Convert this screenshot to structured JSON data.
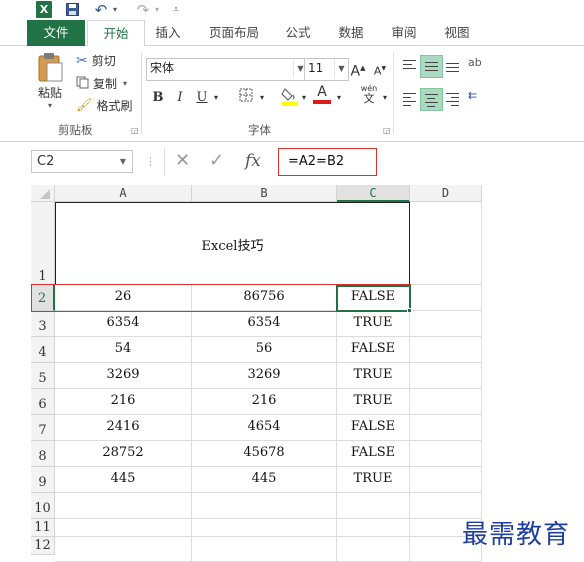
{
  "qat": {
    "excel_icon_letter": "X",
    "undo_glyph": "↶",
    "redo_glyph": "↷"
  },
  "tabs": {
    "file": "文件",
    "home": "开始",
    "insert": "插入",
    "page_layout": "页面布局",
    "formulas": "公式",
    "data": "数据",
    "review": "审阅",
    "view": "视图"
  },
  "clipboard": {
    "paste": "粘贴",
    "cut": "剪切",
    "copy": "复制",
    "format_painter": "格式刷",
    "group_label": "剪贴板"
  },
  "font": {
    "family": "宋体",
    "size": "11",
    "bold": "B",
    "italic": "I",
    "underline": "U",
    "phonetic_top": "wén",
    "phonetic_bottom": "文",
    "group_label": "字体",
    "grow": "A",
    "shrink": "A",
    "font_color_letter": "A"
  },
  "formula_bar": {
    "name_box": "C2",
    "cancel": "✕",
    "enter": "✓",
    "fx": "fx",
    "formula": "=A2=B2"
  },
  "columns": [
    "A",
    "B",
    "C",
    "D"
  ],
  "rows": [
    "1",
    "2",
    "3",
    "4",
    "5",
    "6",
    "7",
    "8",
    "9",
    "10",
    "11",
    "12"
  ],
  "title_cell": "Excel技巧",
  "table": [
    [
      "26",
      "86756",
      "FALSE"
    ],
    [
      "6354",
      "6354",
      "TRUE"
    ],
    [
      "54",
      "56",
      "FALSE"
    ],
    [
      "3269",
      "3269",
      "TRUE"
    ],
    [
      "216",
      "216",
      "TRUE"
    ],
    [
      "2416",
      "4654",
      "FALSE"
    ],
    [
      "28752",
      "45678",
      "FALSE"
    ],
    [
      "445",
      "445",
      "TRUE"
    ]
  ],
  "watermark": "最需教育",
  "colors": {
    "excel_green": "#217346",
    "highlight_red": "#d9302c",
    "watermark_blue": "#1f3f9e"
  }
}
